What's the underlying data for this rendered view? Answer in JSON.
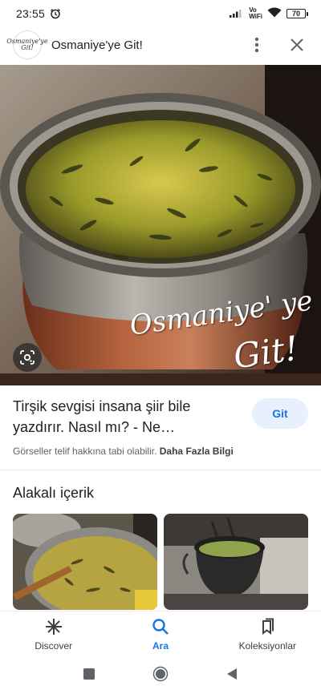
{
  "status_bar": {
    "time": "23:55",
    "network_label_top": "Vo",
    "network_label_bottom": "WiFi",
    "battery": "70"
  },
  "header": {
    "site_logo_text": "Osmaniye'ye Git!",
    "site_title": "Osmaniye'ye Git!",
    "more_icon": "more-vert-icon",
    "close_icon": "close-icon"
  },
  "hero": {
    "watermark_line1": "Osmaniye' ye",
    "watermark_line2": "Git!",
    "lens_icon": "google-lens-icon"
  },
  "result": {
    "title": "Tirşik sevgisi insana şiir bile yazdırır. Nasıl mı? - Ne…",
    "visit_label": "Git",
    "copyright_text": "Görseller telif hakkına tabi olabilir.",
    "more_info_link": "Daha Fazla Bilgi"
  },
  "related": {
    "title": "Alakalı içerik"
  },
  "bottom_nav": {
    "items": [
      {
        "label": "Discover",
        "icon": "asterisk-icon"
      },
      {
        "label": "Ara",
        "icon": "search-icon"
      },
      {
        "label": "Koleksiyonlar",
        "icon": "bookmarks-icon"
      }
    ],
    "active": "Ara"
  },
  "colors": {
    "accent": "#1a73e8",
    "button_bg": "#e8f0fe"
  }
}
